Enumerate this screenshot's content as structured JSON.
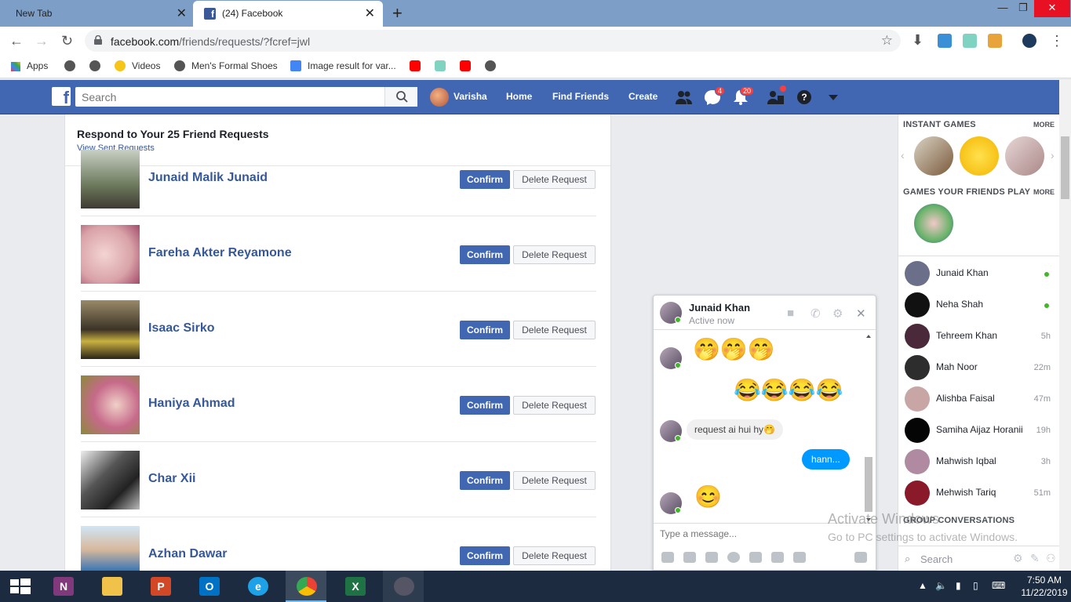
{
  "browser": {
    "tabs": [
      {
        "title": "New Tab"
      },
      {
        "title": "(24) Facebook"
      }
    ],
    "url_host": "facebook.com",
    "url_path": "/friends/requests/?fcref=jwl",
    "bookmarks": [
      "Apps",
      "Videos",
      "Men's Formal Shoes",
      "Image result for var..."
    ]
  },
  "fb_header": {
    "search_placeholder": "Search",
    "user_name": "Varisha",
    "nav": [
      "Home",
      "Find Friends",
      "Create"
    ],
    "messages_badge": "4",
    "notifications_badge": "20"
  },
  "requests": {
    "heading": "Respond to Your 25 Friend Requests",
    "sent_link": "View Sent Requests",
    "confirm_label": "Confirm",
    "delete_label": "Delete Request",
    "items": [
      {
        "name": "Junaid Malik Junaid"
      },
      {
        "name": "Fareha Akter Reyamone"
      },
      {
        "name": "Isaac Sirko"
      },
      {
        "name": "Haniya Ahmad"
      },
      {
        "name": "Char Xii"
      },
      {
        "name": "Azhan Dawar"
      }
    ]
  },
  "chat": {
    "name": "Junaid Khan",
    "status": "Active now",
    "emoji_row1": "🤭🤭🤭",
    "emoji_row2": "😂😂😂😂",
    "message_in": "request ai hui hy🤭",
    "message_out": "hann...",
    "emoji_last": "😊",
    "input_placeholder": "Type a message..."
  },
  "sidebar": {
    "instant_games": "INSTANT GAMES",
    "more": "MORE",
    "games_friends": "GAMES YOUR FRIENDS PLAY",
    "contacts": [
      {
        "name": "Junaid Khan",
        "time": "",
        "online": true,
        "color": "#6b6f8a"
      },
      {
        "name": "Neha Shah",
        "time": "",
        "online": true,
        "color": "#111111"
      },
      {
        "name": "Tehreem Khan",
        "time": "5h",
        "online": false,
        "color": "#4a2a3a"
      },
      {
        "name": "Mah Noor",
        "time": "22m",
        "online": false,
        "color": "#2d2d2d"
      },
      {
        "name": "Alishba Faisal",
        "time": "47m",
        "online": false,
        "color": "#c9a6a6"
      },
      {
        "name": "Samiha Aijaz Horanii",
        "time": "19h",
        "online": false,
        "color": "#050505"
      },
      {
        "name": "Mahwish Iqbal",
        "time": "3h",
        "online": false,
        "color": "#b08aa0"
      },
      {
        "name": "Mehwish Tariq",
        "time": "51m",
        "online": false,
        "color": "#8a1a2a"
      }
    ],
    "group_title": "GROUP CONVERSATIONS",
    "search_placeholder": "Search"
  },
  "watermark": {
    "line1": "Activate Windows",
    "line2": "Go to PC settings to activate Windows."
  },
  "taskbar": {
    "time": "7:50 AM",
    "date": "11/22/2019"
  }
}
